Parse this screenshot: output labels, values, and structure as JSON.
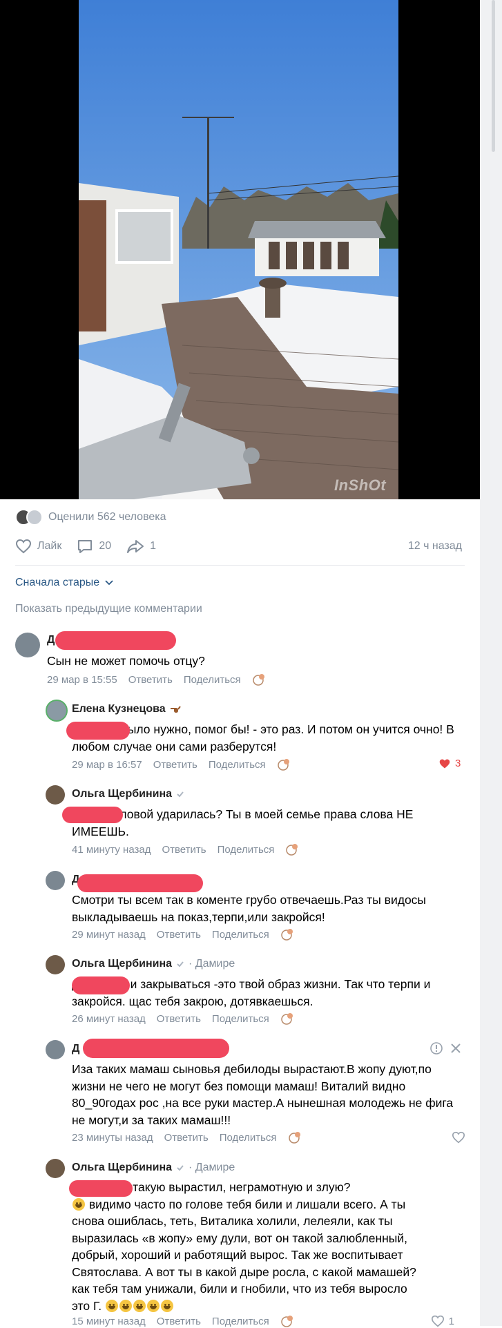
{
  "post": {
    "watermark": "InShOt",
    "likes_text": "Оценили 562 человека",
    "like_label": "Лайк",
    "comments_count": "20",
    "shares_count": "1",
    "time_ago": "12 ч назад"
  },
  "comments_section": {
    "sort_label": "Сначала старые",
    "show_previous": "Показать предыдущие комментарии"
  },
  "comments": [
    {
      "name": "Д",
      "text": "Сын не может помочь отцу?",
      "date": "29 мар в 15:55",
      "reply": "Ответить",
      "share": "Поделиться"
    },
    {
      "name": "Елена Кузнецова",
      "text": "                если бы было нужно, помог бы! - это раз. И потом он учится очно! В любом случае они сами разберутся!",
      "date": "29 мар в 16:57",
      "reply": "Ответить",
      "share": "Поделиться",
      "likes": "3"
    },
    {
      "name": "Ольга Щербинина",
      "text": "                    ты че, головой ударилась? Ты в моей семье права слова НЕ ИМЕЕШЬ.",
      "date": "41 минуту назад",
      "reply": "Ответить",
      "share": "Поделиться"
    },
    {
      "name": "Д",
      "text": "Смотри ты всем так в коменте грубо отвечаешь.Раз ты видосы выкладываешь на показ,терпи,или закройся!",
      "date": "29 минут назад",
      "reply": "Ответить",
      "share": "Поделиться"
    },
    {
      "name": "Ольга Щербинина",
      "reply_to": "· Дамире",
      "text": "Д             терпеть и закрываться -это твой образ жизни. Так что терпи и закройся. щас тебя закрою, дотявкаешься.",
      "date": "26 минут назад",
      "reply": "Ответить",
      "share": "Поделиться"
    },
    {
      "name": "Д",
      "text": "Иза таких мамаш сыновья дебилоды вырастают.В жопу дуют,по жизни не чего не могут без помощи мамаш! Виталий видно 80_90годах рос ,на все руки мастер.А нынешная молодежь не фига не могут,и за таких мамаш!!!",
      "date": "23 минуты назад",
      "reply": "Ответить",
      "share": "Поделиться"
    },
    {
      "name": "Ольга Щербинина",
      "reply_to": "· Дамире",
      "text_lines": [
        "                      кто ж тебя такую вырастил, неграмотную и злую?",
        " видимо часто по голове тебя били и лишали всего. А ты",
        "снова ошиблась, теть, Виталика холили, лелеяли, как ты",
        "выразилась «в жопу» ему дули, вот он такой залюбленный,",
        "добрый, хороший и работящий вырос. Так же воспитывает",
        "Святослава. А вот ты в какой дыре росла, с какой мамашей?",
        "как тебя там унижали, били и гнобили, что из тебя выросло",
        "это Г."
      ],
      "date": "15 минут назад",
      "reply": "Ответить",
      "share": "Поделиться",
      "likes": "1"
    }
  ]
}
